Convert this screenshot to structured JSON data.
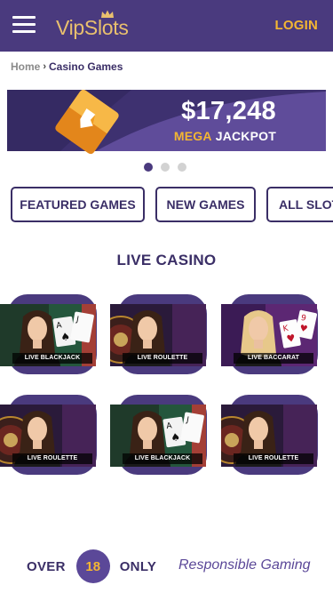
{
  "header": {
    "logo_text": "VipSlots",
    "login_label": "LOGIN"
  },
  "breadcrumb": {
    "home": "Home",
    "separator": "›",
    "current": "Casino Games"
  },
  "jackpot": {
    "amount": "$17,248",
    "label_highlight": "MEGA",
    "label_rest": "JACKPOT"
  },
  "carousel": {
    "slide_count": 3,
    "active_index": 0
  },
  "tabs": [
    {
      "label": "FEATURED GAMES"
    },
    {
      "label": "NEW GAMES"
    },
    {
      "label": "ALL SLOTS"
    }
  ],
  "section": {
    "title": "LIVE CASINO"
  },
  "games": [
    {
      "label": "LIVE BLACKJACK",
      "icon": "blackjack-dealer-icon"
    },
    {
      "label": "LIVE ROULETTE",
      "icon": "roulette-dealer-icon"
    },
    {
      "label": "LIVE BACCARAT",
      "icon": "baccarat-dealer-icon"
    },
    {
      "label": "LIVE ROULETTE",
      "icon": "roulette-dealer-icon"
    },
    {
      "label": "LIVE BLACKJACK",
      "icon": "blackjack-dealer-icon"
    },
    {
      "label": "LIVE ROULETTE",
      "icon": "roulette-dealer-icon"
    }
  ],
  "footer": {
    "over_label": "OVER",
    "age": "18",
    "only_label": "ONLY",
    "responsible_label": "Responsible Gaming"
  },
  "colors": {
    "brand_purple": "#4a3a7e",
    "accent_gold": "#f4b632",
    "text_purple": "#3a2e66"
  }
}
